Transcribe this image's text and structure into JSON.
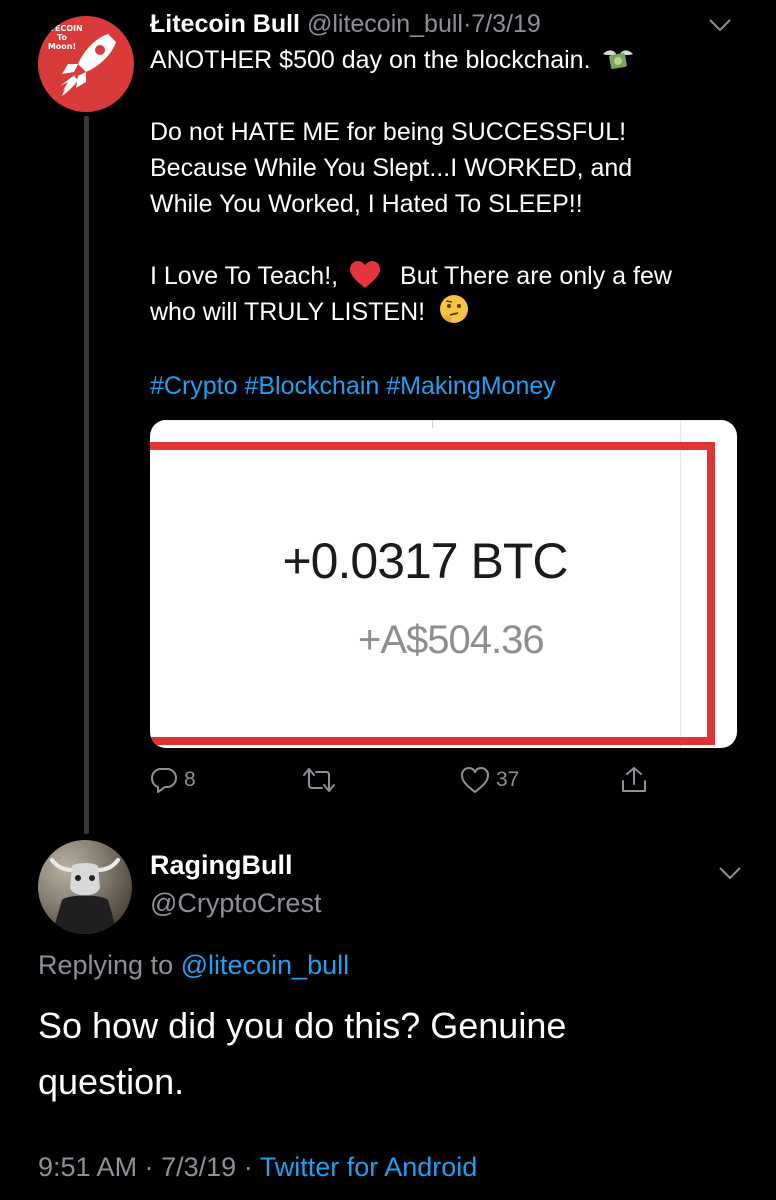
{
  "tweet": {
    "author_name": "Łitecoin Bull",
    "handle": "@litecoin_bull",
    "separator": "·",
    "date": "7/3/19",
    "avatar_text": [
      "LITECOIN",
      "To",
      "Moon!"
    ],
    "lines": [
      "ANOTHER $500 day on the blockchain.",
      "Do not HATE ME for being SUCCESSFUL!",
      "Because While You Slept...I WORKED, and",
      "While You Worked, I Hated To SLEEP!!",
      "I Love To Teach!,",
      "But There are only a few",
      "who will TRULY LISTEN!"
    ],
    "hashtags": "#Crypto #Blockchain #MakingMoney",
    "media": {
      "btc_amount": "+0.0317 BTC",
      "fiat_amount": "+A$504.36"
    },
    "actions": {
      "replies": "8",
      "likes": "37"
    },
    "accent_color": "#1da1f2"
  },
  "reply": {
    "author_name": "RagingBull",
    "handle": "@CryptoCrest",
    "replying_prefix": "Replying to",
    "replying_to": "@litecoin_bull",
    "text": "So how did you do this? Genuine question.",
    "time": "9:51 AM",
    "sep1": "·",
    "date": "7/3/19",
    "sep2": "·",
    "source": "Twitter for Android"
  },
  "icons": [
    "money-with-wings-icon",
    "red-heart-icon",
    "thinking-face-icon",
    "reply-icon",
    "retweet-icon",
    "like-icon",
    "share-icon",
    "chevron-down-icon"
  ]
}
